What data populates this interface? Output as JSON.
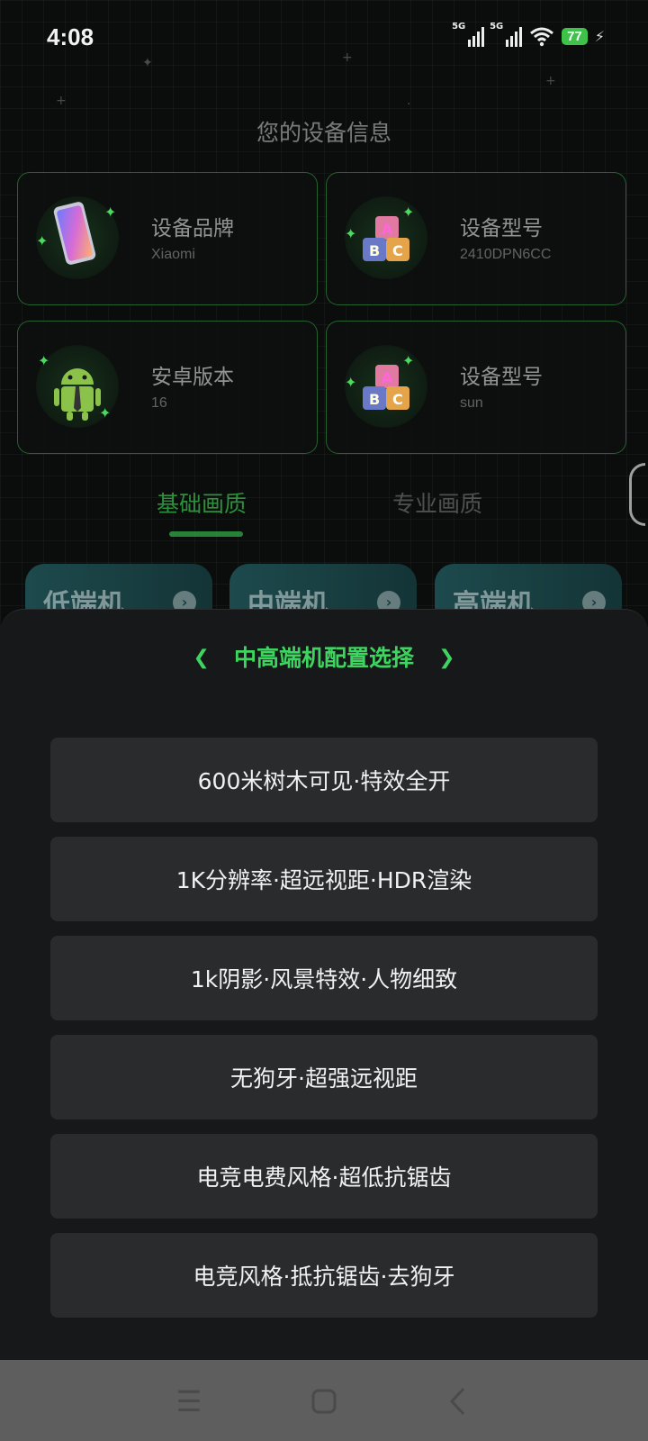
{
  "status_bar": {
    "time": "4:08",
    "network_1": "5G",
    "network_2": "5G",
    "battery": "77"
  },
  "page": {
    "title": "您的设备信息"
  },
  "cards": [
    {
      "label": "设备品牌",
      "value": "Xiaomi",
      "icon": "phone-icon"
    },
    {
      "label": "设备型号",
      "value": "2410DPN6CC",
      "icon": "abc-blocks-icon"
    },
    {
      "label": "安卓版本",
      "value": "16",
      "icon": "android-icon"
    },
    {
      "label": "设备型号",
      "value": "sun",
      "icon": "abc-blocks-icon"
    }
  ],
  "tabs": [
    {
      "label": "基础画质",
      "active": true
    },
    {
      "label": "专业画质",
      "active": false
    }
  ],
  "tiers": [
    {
      "label": "低端机"
    },
    {
      "label": "中端机"
    },
    {
      "label": "高端机"
    }
  ],
  "sheet": {
    "title": "中高端机配置选择",
    "options": [
      "600米树木可见·特效全开",
      "1K分辨率·超远视距·HDR渲染",
      "1k阴影·风景特效·人物细致",
      "无狗牙·超强远视距",
      "电竞电费风格·超低抗锯齿",
      "电竞风格·抵抗锯齿·去狗牙"
    ]
  },
  "colors": {
    "accent": "#3ed460",
    "sheet_bg": "#171819",
    "option_bg": "#2a2b2d",
    "battery": "#3fc24a"
  }
}
